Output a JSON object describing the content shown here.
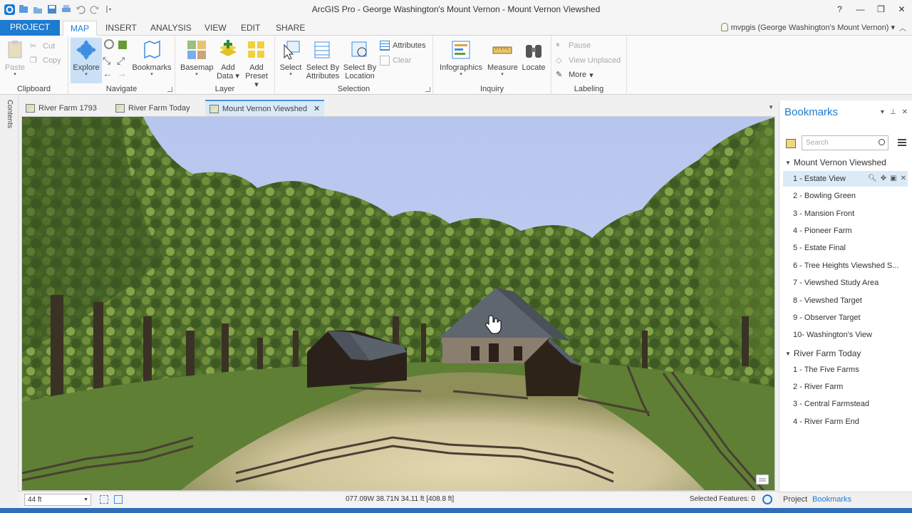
{
  "window": {
    "title": "ArcGIS Pro - George Washington's Mount Vernon - Mount Vernon Viewshed",
    "controls": [
      "?",
      "—",
      "❐",
      "✕"
    ]
  },
  "ribbon_tabs": {
    "project": "PROJECT",
    "tabs": [
      "MAP",
      "INSERT",
      "ANALYSIS",
      "VIEW",
      "EDIT",
      "SHARE"
    ],
    "user": "mvpgis (George Washington's Mount Vernon)"
  },
  "ribbon": {
    "clipboard": {
      "label": "Clipboard",
      "paste": "Paste",
      "cut": "Cut",
      "copy": "Copy"
    },
    "navigate": {
      "label": "Navigate",
      "explore": "Explore",
      "bookmarks": "Bookmarks"
    },
    "layer": {
      "label": "Layer",
      "basemap": "Basemap",
      "add_data_1": "Add",
      "add_data_2": "Data",
      "add_preset_1": "Add",
      "add_preset_2": "Preset"
    },
    "selection": {
      "label": "Selection",
      "select": "Select",
      "sba_1": "Select By",
      "sba_2": "Attributes",
      "sbl_1": "Select By",
      "sbl_2": "Location",
      "attributes": "Attributes",
      "clear": "Clear"
    },
    "inquiry": {
      "label": "Inquiry",
      "infographics": "Infographics",
      "measure": "Measure",
      "locate": "Locate"
    },
    "labeling": {
      "label": "Labeling",
      "pause": "Pause",
      "view_unplaced": "View Unplaced",
      "more": "More"
    }
  },
  "contents_label": "Contents",
  "view_tabs": [
    "River Farm 1793",
    "River Farm Today",
    "Mount Vernon Viewshed"
  ],
  "status": {
    "scale": "44 ft",
    "coords": "077.09W 38.71N  34.11 ft  [408.8 ft]",
    "selected_features": "Selected Features: 0"
  },
  "bookmarks_pane": {
    "title": "Bookmarks",
    "search_placeholder": "Search",
    "collections": [
      {
        "name": "Mount Vernon Viewshed",
        "items": [
          "1 - Estate View",
          "2 - Bowling Green",
          "3 - Mansion Front",
          "4 - Pioneer Farm",
          "5 - Estate Final",
          "6 - Tree Heights Viewshed S...",
          "7 - Viewshed Study Area",
          "8 - Viewshed Target",
          "9 - Observer Target",
          "10- Washington's View"
        ]
      },
      {
        "name": "River Farm Today",
        "items": [
          "1 - The Five Farms",
          "2 - River Farm",
          "3 - Central Farmstead",
          "4 - River Farm End"
        ]
      }
    ],
    "bottom_tabs": [
      "Project",
      "Bookmarks"
    ]
  },
  "colors": {
    "accent": "#1e7bd0",
    "sky": "#b9c8ee",
    "foliage": "#4f6e2a",
    "ground": "#d8cfa6"
  }
}
